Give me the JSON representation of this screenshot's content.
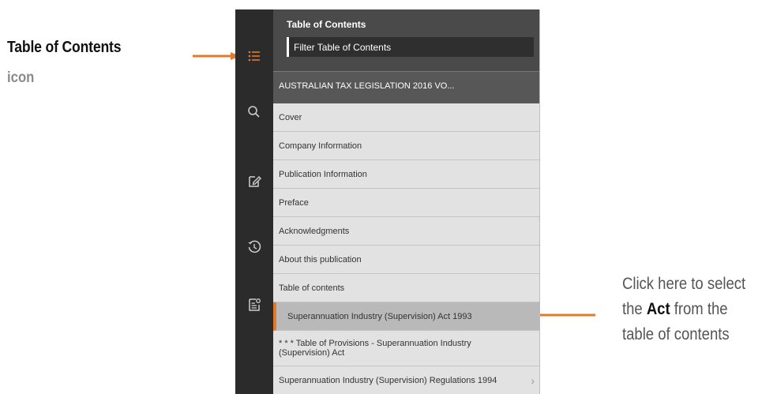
{
  "annotations": {
    "toc_title": "Table of Contents",
    "toc_sub": "icon",
    "right_line1": "Click here to select",
    "right_line2_pre": "the ",
    "right_line2_bold": "Act",
    "right_line2_post": " from the",
    "right_line3": "table of contents",
    "arrow_color": "#e17a2b"
  },
  "rail": {
    "icons": [
      "list-icon",
      "search-icon",
      "edit-note-icon",
      "history-icon",
      "document-settings-icon"
    ],
    "active_color": "#e17a2b"
  },
  "panel": {
    "title": "Table of Contents",
    "filter_placeholder": "Filter Table of Contents",
    "book_title": "AUSTRALIAN TAX LEGISLATION 2016 VO..."
  },
  "toc": {
    "items": [
      {
        "label": "Cover"
      },
      {
        "label": "Company Information"
      },
      {
        "label": "Publication Information"
      },
      {
        "label": "Preface"
      },
      {
        "label": "Acknowledgments"
      },
      {
        "label": "About this publication"
      },
      {
        "label": "Table of contents"
      },
      {
        "label": "Superannuation Industry (Supervision) Act 1993"
      },
      {
        "label": "* * * Table of Provisions - Superannuation Industry (Supervision) Act"
      },
      {
        "label": "Superannuation Industry (Supervision) Regulations 1994",
        "chevron": "›"
      }
    ]
  }
}
